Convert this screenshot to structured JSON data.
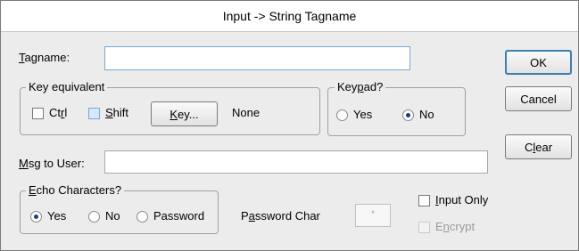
{
  "window": {
    "title": "Input -> String Tagname"
  },
  "tagname": {
    "label": "Tagname:",
    "accel": "T",
    "rest": "agname:",
    "value": ""
  },
  "key_equivalent": {
    "legend": "Key equivalent",
    "ctrl": {
      "pre": "Ct",
      "accel": "r",
      "post": "l",
      "checked": false
    },
    "shift": {
      "accel": "S",
      "rest": "hift",
      "checked": false
    },
    "key_button": {
      "accel": "K",
      "rest": "ey..."
    },
    "value": "None"
  },
  "keypad": {
    "legend": "Keypad?",
    "legend_pre": "Key",
    "legend_accel": "p",
    "legend_post": "ad?",
    "options": [
      "Yes",
      "No"
    ],
    "selected": "No"
  },
  "msg_to_user": {
    "accel": "M",
    "rest": "sg to User:",
    "value": ""
  },
  "echo": {
    "legend_accel": "E",
    "legend_rest": "cho Characters?",
    "options": [
      "Yes",
      "No",
      "Password"
    ],
    "selected": "Yes"
  },
  "password_char": {
    "pre": "P",
    "accel": "a",
    "post": "ssword Char",
    "value": "*"
  },
  "input_only": {
    "accel": "I",
    "rest": "nput Only",
    "checked": false
  },
  "encrypt": {
    "pre": "E",
    "accel": "n",
    "post": "crypt",
    "checked": false,
    "enabled": false
  },
  "buttons": {
    "ok": "OK",
    "cancel": "Cancel",
    "clear_pre": "C",
    "clear_accel": "l",
    "clear_post": "ear"
  }
}
